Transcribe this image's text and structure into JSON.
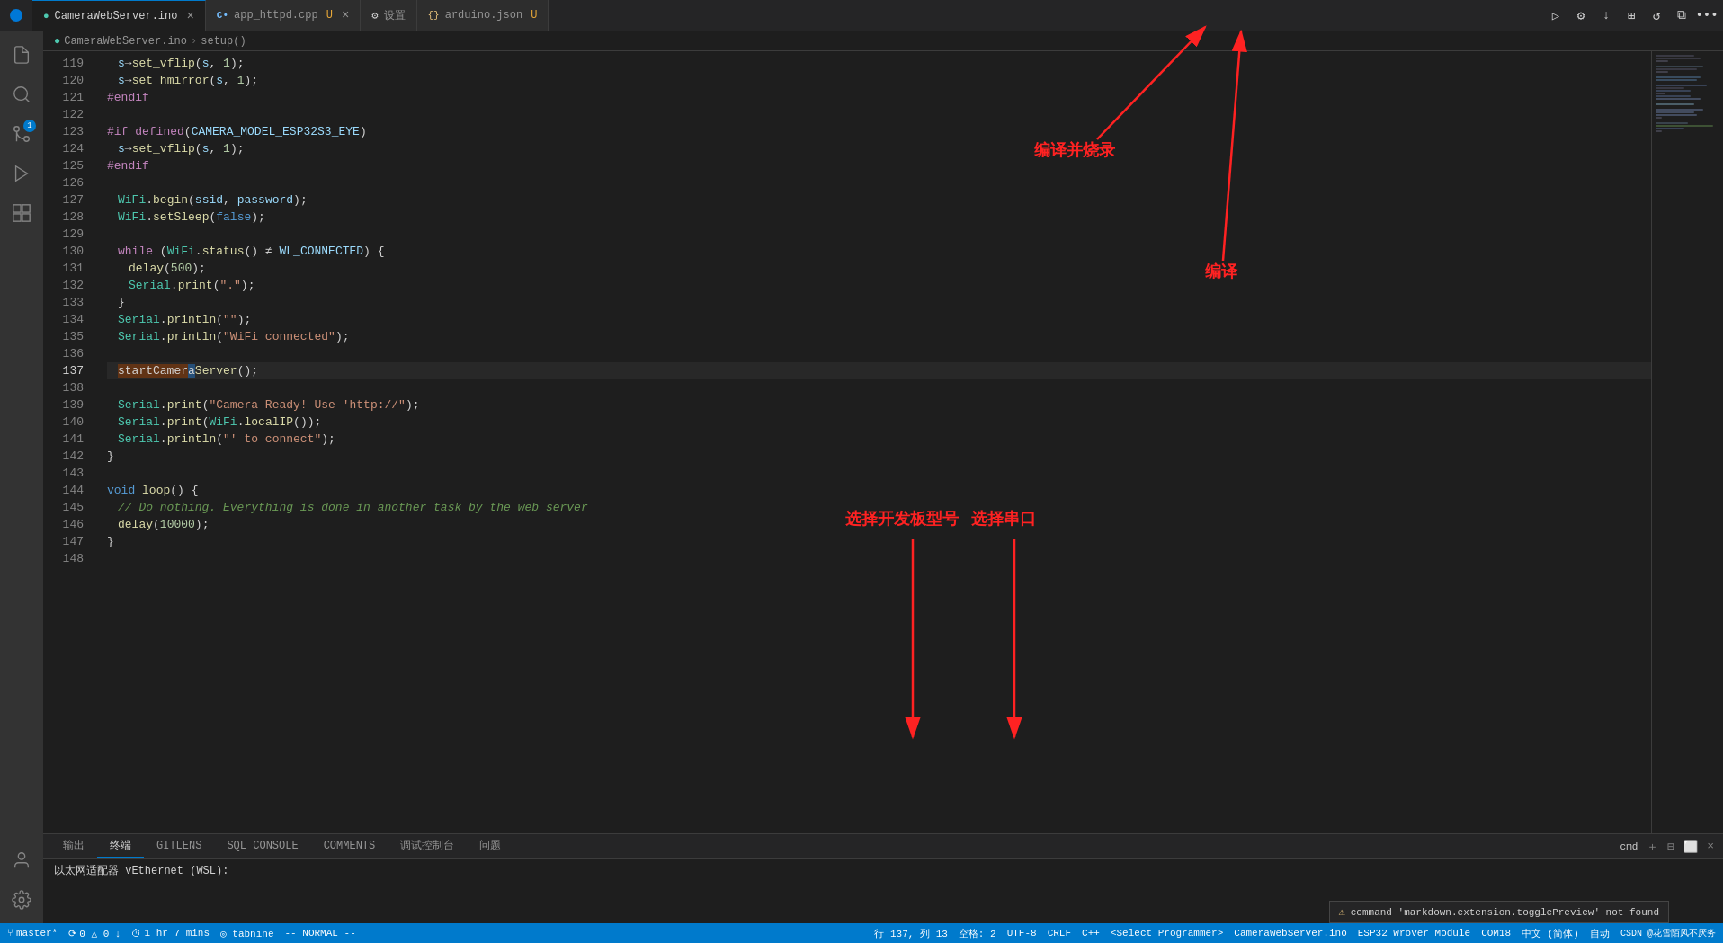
{
  "titleBar": {
    "tabs": [
      {
        "id": "tab-ino",
        "label": "CameraWebServer.ino",
        "icon": "dot-blue",
        "active": true,
        "modified": false
      },
      {
        "id": "tab-cpp",
        "label": "app_httpd.cpp",
        "icon": "cpp",
        "active": false,
        "modified": true
      },
      {
        "id": "tab-settings",
        "label": "设置",
        "icon": "gear",
        "active": false,
        "modified": false
      },
      {
        "id": "tab-json",
        "label": "arduino.json",
        "icon": "json",
        "active": false,
        "modified": true
      }
    ],
    "actions": [
      "run",
      "settings",
      "download",
      "layout",
      "history",
      "split",
      "close"
    ]
  },
  "breadcrumb": {
    "parts": [
      "CameraWebServer.ino",
      "setup()"
    ]
  },
  "codeLines": [
    {
      "num": 119,
      "content": "s→set_vflip(s, 1);"
    },
    {
      "num": 120,
      "content": "s→set_hmirror(s, 1);"
    },
    {
      "num": 121,
      "content": "#endif"
    },
    {
      "num": 122,
      "content": ""
    },
    {
      "num": 123,
      "content": "#if defined(CAMERA_MODEL_ESP32S3_EYE)"
    },
    {
      "num": 124,
      "content": "  s→set_vflip(s, 1);"
    },
    {
      "num": 125,
      "content": "#endif"
    },
    {
      "num": 126,
      "content": ""
    },
    {
      "num": 127,
      "content": "  WiFi.begin(ssid, password);"
    },
    {
      "num": 128,
      "content": "  WiFi.setSleep(false);"
    },
    {
      "num": 129,
      "content": ""
    },
    {
      "num": 130,
      "content": "  while (WiFi.status() ≠ WL_CONNECTED) {"
    },
    {
      "num": 131,
      "content": "    delay(500);"
    },
    {
      "num": 132,
      "content": "    Serial.print(\".\");"
    },
    {
      "num": 133,
      "content": "  }"
    },
    {
      "num": 134,
      "content": "  Serial.println(\"\");"
    },
    {
      "num": 135,
      "content": "  Serial.println(\"WiFi connected\");"
    },
    {
      "num": 136,
      "content": ""
    },
    {
      "num": 137,
      "content": "  startCameraServer();"
    },
    {
      "num": 138,
      "content": ""
    },
    {
      "num": 139,
      "content": "  Serial.print(\"Camera Ready! Use 'http://\");"
    },
    {
      "num": 140,
      "content": "  Serial.print(WiFi.localIP());"
    },
    {
      "num": 141,
      "content": "  Serial.println(\"' to connect\");"
    },
    {
      "num": 142,
      "content": "}"
    },
    {
      "num": 143,
      "content": ""
    },
    {
      "num": 144,
      "content": "void loop() {"
    },
    {
      "num": 145,
      "content": "  // Do nothing. Everything is done in another task by the web server"
    },
    {
      "num": 146,
      "content": "  delay(10000);"
    },
    {
      "num": 147,
      "content": "}"
    },
    {
      "num": 148,
      "content": ""
    }
  ],
  "annotations": {
    "compileAndUpload": "编译并烧录",
    "compile": "编译",
    "selectBoard": "选择开发板型号",
    "selectPort": "选择串口"
  },
  "panel": {
    "tabs": [
      {
        "id": "output",
        "label": "输出",
        "active": false
      },
      {
        "id": "terminal",
        "label": "终端",
        "active": true
      },
      {
        "id": "gitlens",
        "label": "GITLENS",
        "active": false
      },
      {
        "id": "sql",
        "label": "SQL CONSOLE",
        "active": false
      },
      {
        "id": "comments",
        "label": "COMMENTS",
        "active": false
      },
      {
        "id": "debug",
        "label": "调试控制台",
        "active": false
      },
      {
        "id": "problems",
        "label": "问题",
        "active": false
      }
    ],
    "terminalContent": "以太网适配器 vEthernet (WSL):"
  },
  "statusBar": {
    "branch": "master*",
    "sync": "0 △ 0 ↓",
    "time": "1 hr 7 mins",
    "tabnine": "◎ tabnine",
    "mode": "-- NORMAL --",
    "position": "行 137, 列 13",
    "spaces": "空格: 2",
    "encoding": "UTF-8",
    "lineending": "CRLF",
    "language": "C++",
    "programmer": "<Select Programmer>",
    "board": "CameraWebServer.ino",
    "target": "ESP32 Wrover Module",
    "port": "COM18",
    "locale": "中文 (简体)",
    "auto": "自动",
    "csdn": "CSDN @花雪陌风不厌务",
    "warningMsg": "command 'markdown.extension.togglePreview' not found"
  },
  "activityBar": {
    "icons": [
      {
        "id": "files",
        "symbol": "📄",
        "active": false
      },
      {
        "id": "search",
        "symbol": "🔍",
        "active": false
      },
      {
        "id": "git",
        "symbol": "⑂",
        "active": false,
        "badge": ""
      },
      {
        "id": "debug",
        "symbol": "▷",
        "active": false
      },
      {
        "id": "extensions",
        "symbol": "⧉",
        "active": false
      },
      {
        "id": "remote",
        "symbol": "◎",
        "active": false
      },
      {
        "id": "accounts",
        "symbol": "👤",
        "active": false
      },
      {
        "id": "settings",
        "symbol": "⚙",
        "active": false
      }
    ]
  }
}
